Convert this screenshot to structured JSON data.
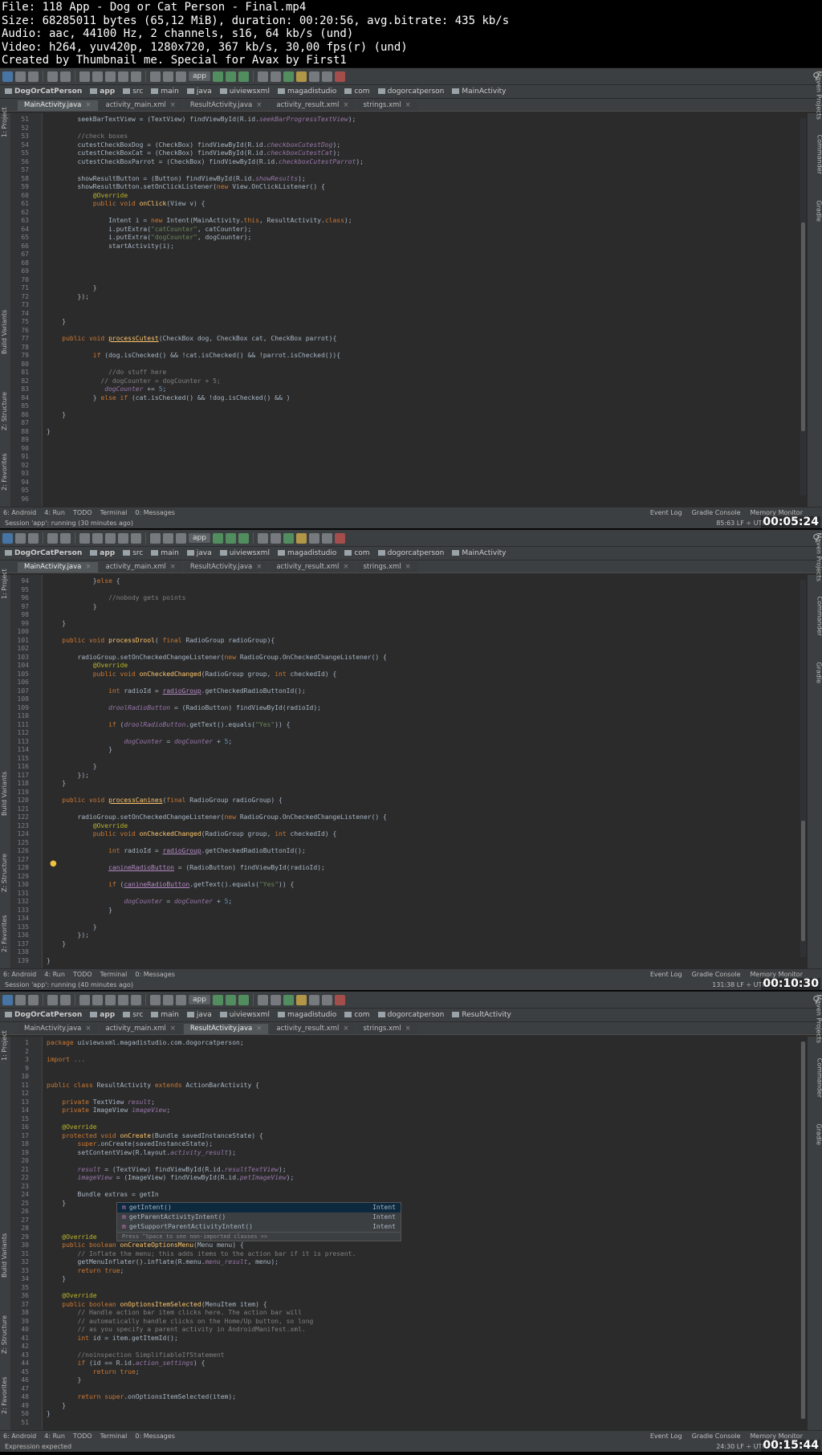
{
  "header": {
    "lines": [
      "File: 118 App - Dog or Cat Person - Final.mp4",
      "Size: 68285011 bytes (65,12 MiB), duration: 00:20:56, avg.bitrate: 435 kb/s",
      "Audio: aac, 44100 Hz, 2 channels, s16, 64 kb/s (und)",
      "Video: h264, yuv420p, 1280x720, 367 kb/s, 30,00 fps(r) (und)",
      "Created by Thumbnail me. Special for Avax by First1"
    ]
  },
  "ide": {
    "app_selector": "app",
    "left_tools": [
      "1: Project",
      "Build Variants",
      "Z: Structure",
      "2: Favorites"
    ],
    "right_tools": [
      "Maven Projects",
      "Commander",
      "Gradle"
    ],
    "bottom_tools": [
      "6: Android",
      "4: Run",
      "TODO",
      "Terminal",
      "0: Messages"
    ],
    "bottom_right_tools": [
      "Event Log",
      "Gradle Console",
      "Memory Monitor"
    ]
  },
  "frames": [
    {
      "breadcrumb": [
        "DogOrCatPerson",
        "app",
        "src",
        "main",
        "java",
        "uiviewsxml",
        "magadistudio",
        "com",
        "dogorcatperson",
        "MainActivity"
      ],
      "tabs": [
        "MainActivity.java",
        "activity_main.xml",
        "ResultActivity.java",
        "activity_result.xml",
        "strings.xml"
      ],
      "active_tab": 0,
      "line_numbers": [
        "51",
        "52",
        "53",
        "54",
        "55",
        "56",
        "57",
        "58",
        "59",
        "60",
        "61",
        "62",
        "63",
        "64",
        "65",
        "66",
        "67",
        "68",
        "69",
        "70",
        "71",
        "72",
        "73",
        "74",
        "75",
        "76",
        "77",
        "78",
        "79",
        "80",
        "81",
        "82",
        "83",
        "84",
        "85",
        "86",
        "87",
        "88",
        "89",
        "90",
        "91",
        "92",
        "93",
        "94",
        "95",
        "96"
      ],
      "status": "Session 'app': running (30 minutes ago)",
      "cursor": "85:63  LF ÷ UTF",
      "timestamp": "00:05:24"
    },
    {
      "breadcrumb": [
        "DogOrCatPerson",
        "app",
        "src",
        "main",
        "java",
        "uiviewsxml",
        "magadistudio",
        "com",
        "dogorcatperson",
        "MainActivity"
      ],
      "tabs": [
        "MainActivity.java",
        "activity_main.xml",
        "ResultActivity.java",
        "activity_result.xml",
        "strings.xml"
      ],
      "active_tab": 0,
      "line_numbers": [
        "94",
        "95",
        "96",
        "97",
        "98",
        "99",
        "100",
        "101",
        "102",
        "103",
        "104",
        "105",
        "106",
        "107",
        "108",
        "109",
        "110",
        "111",
        "112",
        "113",
        "114",
        "115",
        "116",
        "117",
        "118",
        "119",
        "120",
        "121",
        "122",
        "123",
        "124",
        "125",
        "126",
        "127",
        "128",
        "129",
        "130",
        "131",
        "132",
        "133",
        "134",
        "135",
        "136",
        "137",
        "138",
        "139"
      ],
      "status": "Session 'app': running (40 minutes ago)",
      "cursor": "131:38  LF ÷ UTF",
      "timestamp": "00:10:30"
    },
    {
      "breadcrumb": [
        "DogOrCatPerson",
        "app",
        "src",
        "main",
        "java",
        "uiviewsxml",
        "magadistudio",
        "com",
        "dogorcatperson",
        "ResultActivity"
      ],
      "tabs": [
        "MainActivity.java",
        "activity_main.xml",
        "ResultActivity.java",
        "activity_result.xml",
        "strings.xml"
      ],
      "active_tab": 2,
      "line_numbers": [
        "1",
        "2",
        "3",
        "9",
        "10",
        "11",
        "12",
        "13",
        "14",
        "15",
        "16",
        "17",
        "18",
        "19",
        "20",
        "21",
        "22",
        "23",
        "24",
        "25",
        "26",
        "27",
        "28",
        "29",
        "30",
        "31",
        "32",
        "33",
        "34",
        "35",
        "36",
        "37",
        "38",
        "39",
        "40",
        "41",
        "42",
        "43",
        "44",
        "45",
        "46",
        "47",
        "48",
        "49",
        "50",
        "51"
      ],
      "completion": [
        {
          "name": "getIntent()",
          "type": "Intent"
        },
        {
          "name": "getParentActivityIntent()",
          "type": "Intent"
        },
        {
          "name": "getSupportParentActivityIntent()",
          "type": "Intent"
        }
      ],
      "completion_footer": "Press ^Space to see non-imported classes >>",
      "status": "Expression expected",
      "cursor": "24:30  LF ÷ UTF",
      "timestamp": "00:15:44"
    }
  ]
}
